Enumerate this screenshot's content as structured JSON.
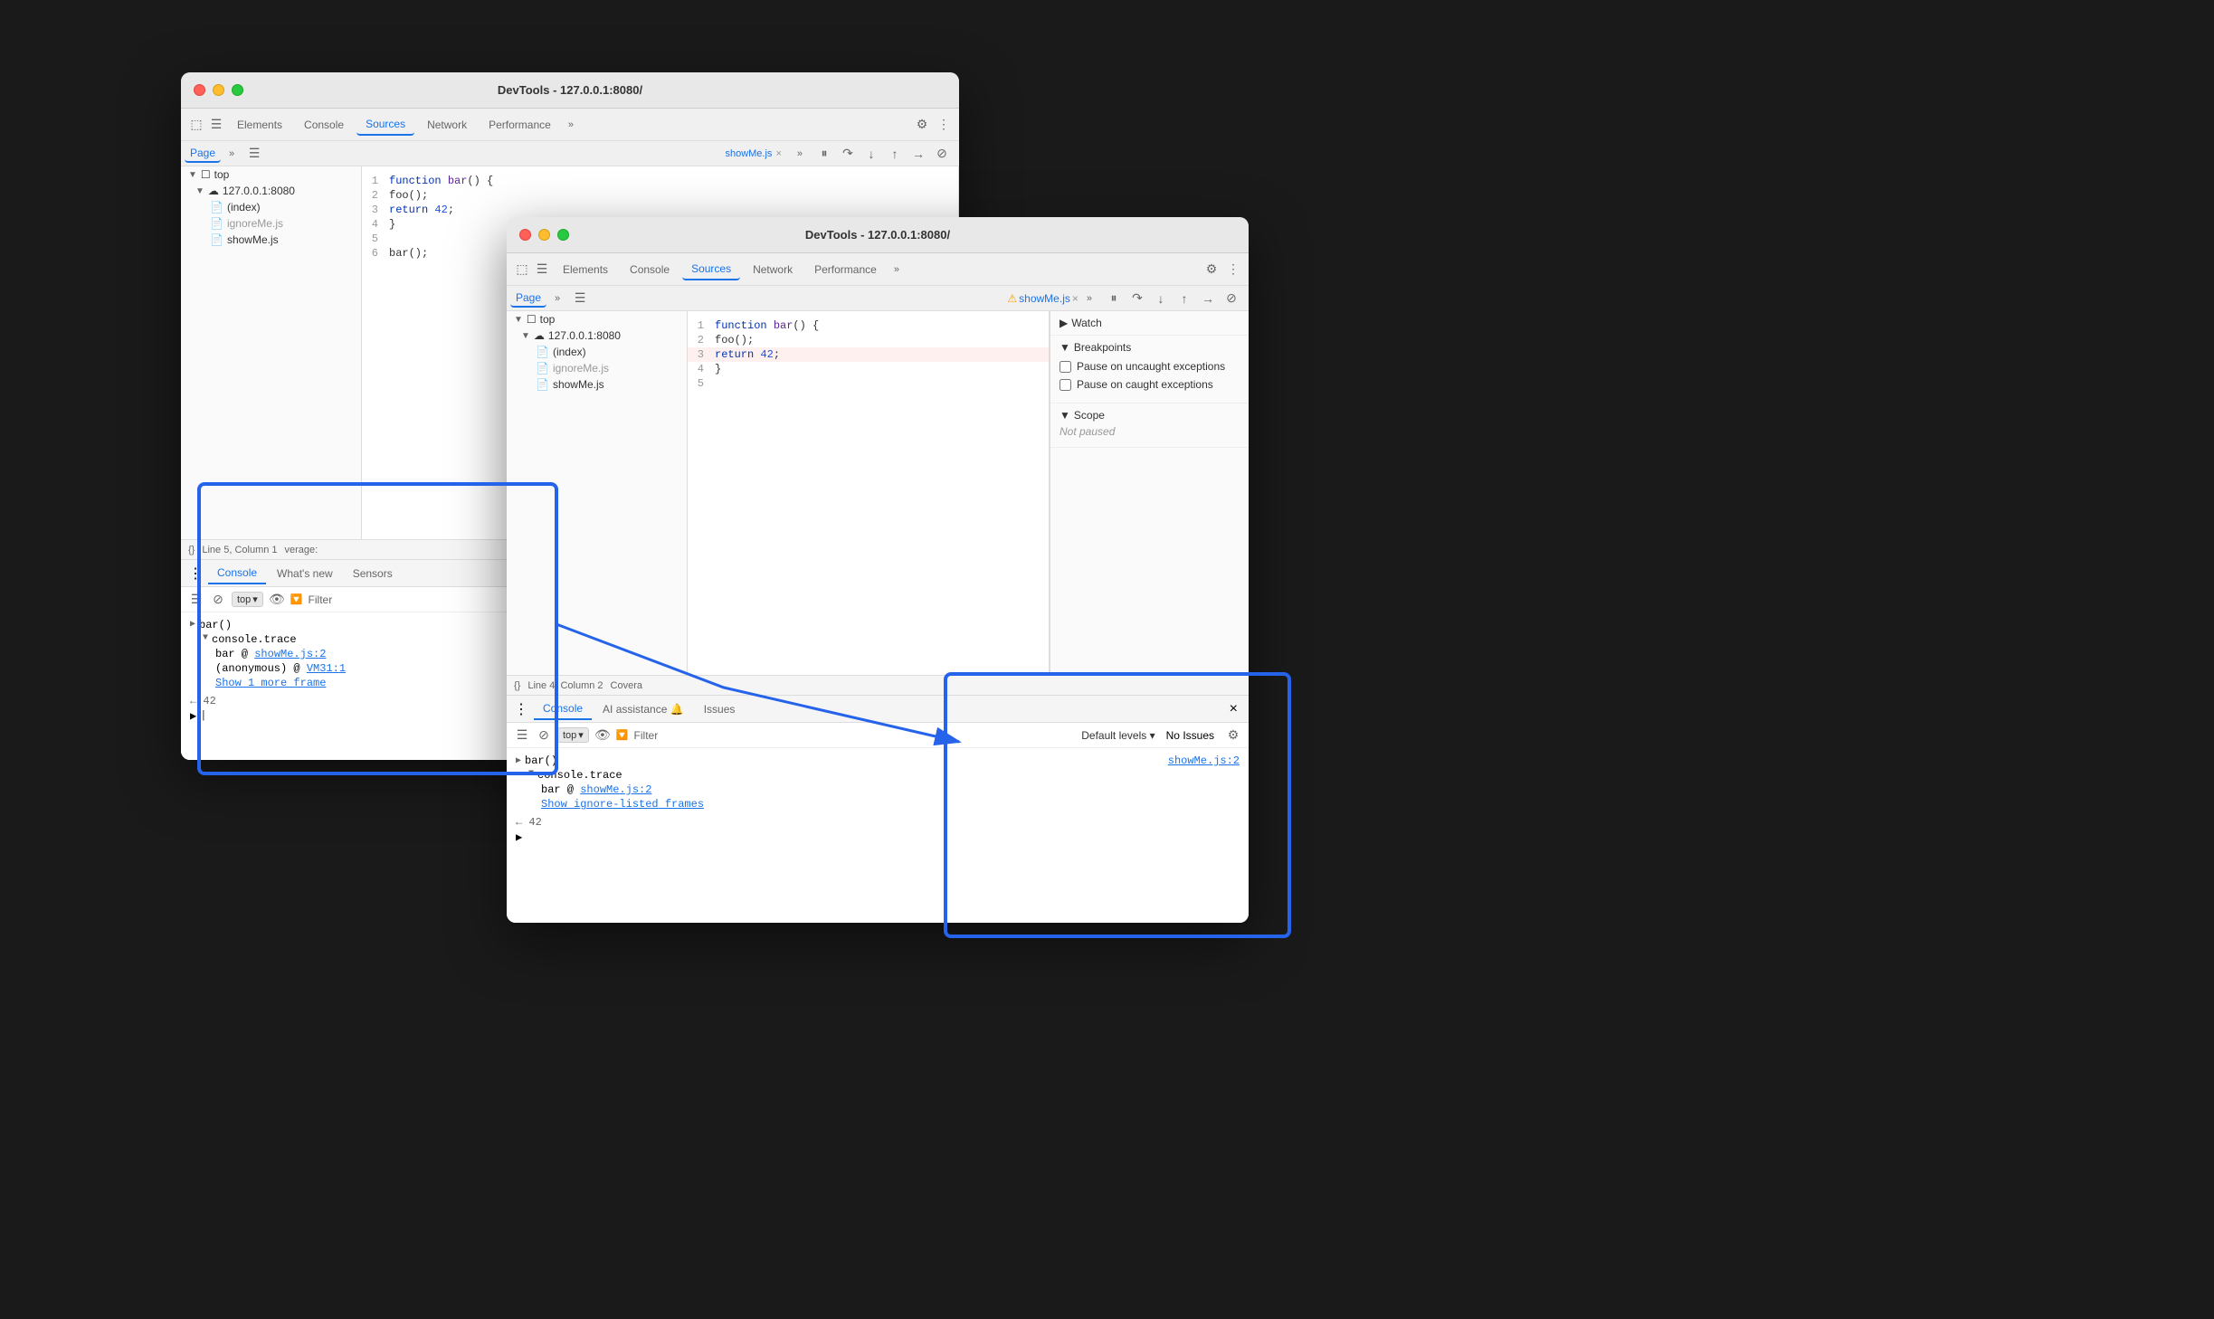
{
  "bg_window": {
    "title": "DevTools - 127.0.0.1:8080/",
    "tabs": {
      "elements": "Elements",
      "console": "Console",
      "sources": "Sources",
      "network": "Network",
      "performance": "Performance",
      "more": "»"
    },
    "second_toolbar": {
      "page": "Page",
      "more": "»"
    },
    "file_tabs": {
      "showme": "showMe.js",
      "close": "×",
      "more": "»"
    },
    "sidebar": {
      "top_label": "top",
      "server": "127.0.0.1:8080",
      "index": "(index)",
      "ignoreme": "ignoreMe.js",
      "showme": "showMe.js"
    },
    "code": {
      "lines": [
        {
          "num": "1",
          "text": "function bar() {"
        },
        {
          "num": "2",
          "text": "  foo();"
        },
        {
          "num": "3",
          "text": "  return 42;"
        },
        {
          "num": "4",
          "text": "}"
        },
        {
          "num": "5",
          "text": ""
        },
        {
          "num": "6",
          "text": "bar();"
        }
      ]
    },
    "status": "Line 5, Column 1",
    "status2": "verage:",
    "console_tabs": {
      "console": "Console",
      "whatsnew": "What's new",
      "sensors": "Sensors"
    },
    "console_toolbar": {
      "top": "top",
      "filter": "Filter"
    },
    "console_entries": [
      {
        "type": "group",
        "label": "bar()",
        "children": [
          {
            "label": "console.trace",
            "expanded": true
          },
          {
            "indent": true,
            "parts": [
              {
                "text": "bar"
              },
              {
                "text": " @ "
              },
              {
                "link": "showMe.js:2"
              }
            ]
          },
          {
            "indent": true,
            "parts": [
              {
                "text": "(anonymous)"
              },
              {
                "text": " @ "
              },
              {
                "link": "VM31:1"
              }
            ]
          },
          {
            "indent": true,
            "parts": [
              {
                "link": "Show 1 more frame",
                "underline": true
              }
            ]
          }
        ]
      },
      {
        "label": "← 42",
        "type": "return"
      },
      {
        "label": ">",
        "type": "prompt"
      }
    ]
  },
  "fg_window": {
    "title": "DevTools - 127.0.0.1:8080/",
    "tabs": {
      "elements": "Elements",
      "console": "Console",
      "sources": "Sources",
      "network": "Network",
      "performance": "Performance",
      "more": "»"
    },
    "second_toolbar": {
      "page": "Page",
      "more": "»"
    },
    "file_tabs": {
      "showme": "showMe.js",
      "close": "×",
      "more": "»"
    },
    "sidebar": {
      "top_label": "top",
      "server": "127.0.0.1:8080",
      "index": "(index)",
      "ignoreme": "ignoreMe.js",
      "showme": "showMe.js"
    },
    "code": {
      "lines": [
        {
          "num": "1",
          "text": "function bar() {"
        },
        {
          "num": "2",
          "text": "  foo();"
        },
        {
          "num": "3",
          "text": "  return 42;"
        },
        {
          "num": "4",
          "text": "}"
        },
        {
          "num": "5",
          "text": ""
        }
      ]
    },
    "status": "Line 4, Column 2",
    "status2": "Covera",
    "right_panel": {
      "watch": "Watch",
      "breakpoints": "Breakpoints",
      "pause_uncaught": "Pause on uncaught exceptions",
      "pause_caught": "Pause on caught exceptions",
      "scope": "Scope",
      "not_paused": "Not paused"
    },
    "console_tabs": {
      "console": "Console",
      "ai": "AI assistance 🔔",
      "issues": "Issues",
      "close": "×"
    },
    "console_toolbar": {
      "top": "top",
      "filter": "Filter",
      "default_levels": "Default levels",
      "no_issues": "No Issues"
    },
    "console_entries": [
      {
        "type": "group",
        "label": "bar()",
        "children": [
          {
            "label": "console.trace",
            "expanded": true
          },
          {
            "indent": true,
            "parts": [
              {
                "text": "bar @ "
              },
              {
                "link": "showMe.js:2"
              }
            ]
          },
          {
            "indent": true,
            "parts": [
              {
                "link": "Show ignore-listed frames",
                "underline": true
              }
            ]
          }
        ]
      },
      {
        "label": "← 42",
        "type": "return"
      },
      {
        "label": ">",
        "type": "prompt"
      }
    ],
    "source_link": "showMe.js:2"
  },
  "colors": {
    "blue_highlight": "#2563eb",
    "active_tab": "#1a73e8",
    "link": "#1a73e8",
    "warning": "#f59e0b"
  }
}
